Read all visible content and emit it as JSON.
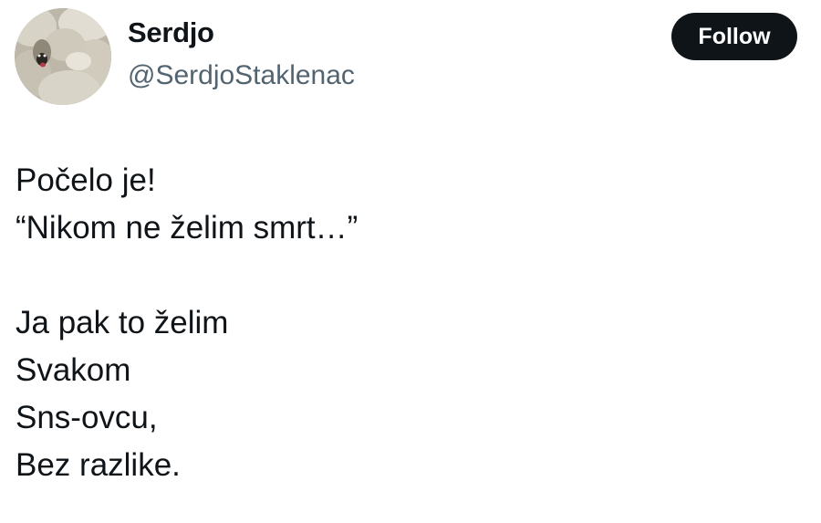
{
  "author": {
    "display_name": "Serdjo",
    "handle": "@SerdjoStaklenac",
    "avatar_icon": "sheep-avatar-icon"
  },
  "follow_button": {
    "label": "Follow",
    "background": "#0f1419",
    "text_color": "#ffffff"
  },
  "tweet": {
    "lines": [
      "Počelo je!",
      "“Nikom ne želim smrt…”",
      "",
      "Ja pak to želim",
      "Svakom",
      "Sns-ovcu,",
      "Bez razlike."
    ]
  },
  "colors": {
    "text": "#0f1419",
    "secondary_text": "#536471",
    "background": "#ffffff"
  }
}
